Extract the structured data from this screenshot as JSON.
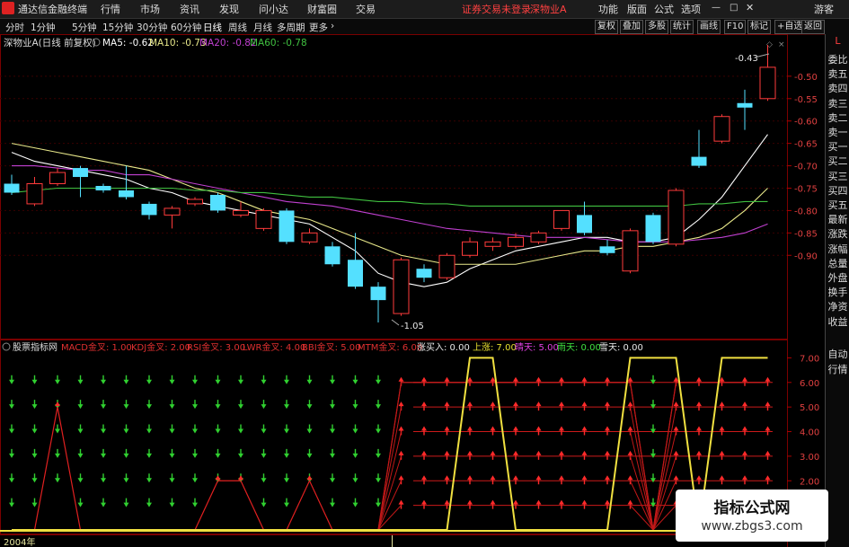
{
  "app": {
    "title": "通达信金融终端",
    "menu": [
      "行情",
      "市场",
      "资讯",
      "发现",
      "问小达",
      "财富圈",
      "交易"
    ],
    "status_text": "证券交易未登录",
    "stock_name": "深物业A",
    "right_menu": [
      "功能",
      "版面",
      "公式",
      "选项"
    ],
    "guest": "游客"
  },
  "periods": [
    "分时",
    "1分钟",
    "5分钟",
    "15分钟",
    "30分钟",
    "60分钟",
    "日线",
    "周线",
    "月线",
    "多周期",
    "更多"
  ],
  "active_period": "日线",
  "toolbar": [
    "复权",
    "叠加",
    "多股",
    "统计",
    "画线",
    "F10",
    "标记",
    "+自选",
    "返回"
  ],
  "main_legend": {
    "title": "深物业A(日线 前复权)",
    "items": [
      {
        "label": "MA5: -0.62",
        "color": "#ffffff"
      },
      {
        "label": "MA10: -0.73",
        "color": "#e8e88a"
      },
      {
        "label": "MA20: -0.82",
        "color": "#c040d0"
      },
      {
        "label": "MA60: -0.78",
        "color": "#40c040"
      }
    ]
  },
  "annotations": {
    "high": "-0.43",
    "low": "-1.05"
  },
  "price_axis": [
    "-0.50",
    "-0.55",
    "-0.60",
    "-0.65",
    "-0.70",
    "-0.75",
    "-0.80",
    "-0.85",
    "-0.90"
  ],
  "indicator_legend": {
    "title": "股票指标网",
    "items": [
      {
        "label": "MACD金叉: 1.00",
        "color": "#e03030"
      },
      {
        "label": "KDJ金叉: 2.00",
        "color": "#e03030"
      },
      {
        "label": "RSI金叉: 3.00",
        "color": "#e03030"
      },
      {
        "label": "LWR金叉: 4.00",
        "color": "#e03030"
      },
      {
        "label": "BBI金叉: 5.00",
        "color": "#e03030"
      },
      {
        "label": "MTM金叉: 6.00",
        "color": "#e03030"
      },
      {
        "label": "涨买入: 0.00",
        "color": "#e8e8e8"
      },
      {
        "label": "上涨: 7.00",
        "color": "#e8e030"
      },
      {
        "label": "晴天: 5.00",
        "color": "#e040e0"
      },
      {
        "label": "雨天: 0.00",
        "color": "#40e040"
      },
      {
        "label": "雪天: 0.00",
        "color": "#e8e8e8"
      }
    ]
  },
  "indicator_axis": [
    "7.00",
    "6.00",
    "5.00",
    "4.00",
    "3.00",
    "2.00"
  ],
  "date_label": "2004年",
  "side_panel": {
    "top": "L",
    "items": [
      "委比",
      "卖五",
      "卖四",
      "卖三",
      "卖二",
      "卖一",
      "买一",
      "买二",
      "买三",
      "买四",
      "买五",
      "最新",
      "涨跌",
      "涨幅",
      "总量",
      "外盘",
      "换手",
      "净资",
      "收益"
    ],
    "bottom": [
      "自动",
      "行情"
    ]
  },
  "watermark": {
    "line1": "指标公式网",
    "line2": "www.zbgs3.com"
  },
  "chart_data": {
    "type": "candlestick",
    "price_ylim": [
      -1.08,
      -0.41
    ],
    "candles": [
      {
        "o": -0.76,
        "c": -0.74,
        "h": -0.72,
        "l": -0.765,
        "up": false
      },
      {
        "o": -0.74,
        "c": -0.785,
        "h": -0.725,
        "l": -0.79,
        "up": true
      },
      {
        "o": -0.715,
        "c": -0.74,
        "h": -0.705,
        "l": -0.745,
        "up": true
      },
      {
        "o": -0.705,
        "c": -0.725,
        "h": -0.7,
        "l": -0.77,
        "up": false
      },
      {
        "o": -0.745,
        "c": -0.755,
        "h": -0.74,
        "l": -0.76,
        "up": false
      },
      {
        "o": -0.755,
        "c": -0.77,
        "h": -0.7,
        "l": -0.775,
        "up": false
      },
      {
        "o": -0.785,
        "c": -0.81,
        "h": -0.78,
        "l": -0.82,
        "up": false
      },
      {
        "o": -0.795,
        "c": -0.81,
        "h": -0.79,
        "l": -0.84,
        "up": true
      },
      {
        "o": -0.775,
        "c": -0.785,
        "h": -0.77,
        "l": -0.79,
        "up": true
      },
      {
        "o": -0.765,
        "c": -0.8,
        "h": -0.76,
        "l": -0.805,
        "up": false
      },
      {
        "o": -0.8,
        "c": -0.81,
        "h": -0.78,
        "l": -0.815,
        "up": true
      },
      {
        "o": -0.8,
        "c": -0.84,
        "h": -0.795,
        "l": -0.845,
        "up": true
      },
      {
        "o": -0.8,
        "c": -0.87,
        "h": -0.795,
        "l": -0.875,
        "up": false
      },
      {
        "o": -0.85,
        "c": -0.87,
        "h": -0.84,
        "l": -0.875,
        "up": true
      },
      {
        "o": -0.88,
        "c": -0.92,
        "h": -0.87,
        "l": -0.925,
        "up": false
      },
      {
        "o": -0.91,
        "c": -0.97,
        "h": -0.85,
        "l": -0.975,
        "up": false
      },
      {
        "o": -0.97,
        "c": -1.0,
        "h": -0.96,
        "l": -1.05,
        "up": false
      },
      {
        "o": -1.03,
        "c": -0.91,
        "h": -0.905,
        "l": -1.035,
        "up": true
      },
      {
        "o": -0.93,
        "c": -0.95,
        "h": -0.92,
        "l": -0.96,
        "up": false
      },
      {
        "o": -0.95,
        "c": -0.9,
        "h": -0.895,
        "l": -0.955,
        "up": true
      },
      {
        "o": -0.9,
        "c": -0.87,
        "h": -0.86,
        "l": -0.905,
        "up": true
      },
      {
        "o": -0.88,
        "c": -0.87,
        "h": -0.86,
        "l": -0.89,
        "up": true
      },
      {
        "o": -0.88,
        "c": -0.86,
        "h": -0.85,
        "l": -0.885,
        "up": true
      },
      {
        "o": -0.87,
        "c": -0.85,
        "h": -0.845,
        "l": -0.875,
        "up": true
      },
      {
        "o": -0.84,
        "c": -0.8,
        "h": -0.8,
        "l": -0.845,
        "up": true
      },
      {
        "o": -0.81,
        "c": -0.85,
        "h": -0.78,
        "l": -0.855,
        "up": false
      },
      {
        "o": -0.88,
        "c": -0.895,
        "h": -0.865,
        "l": -0.9,
        "up": false
      },
      {
        "o": -0.935,
        "c": -0.845,
        "h": -0.84,
        "l": -0.94,
        "up": true
      },
      {
        "o": -0.81,
        "c": -0.87,
        "h": -0.805,
        "l": -0.875,
        "up": false
      },
      {
        "o": -0.875,
        "c": -0.755,
        "h": -0.75,
        "l": -0.88,
        "up": true
      },
      {
        "o": -0.7,
        "c": -0.68,
        "h": -0.62,
        "l": -0.705,
        "up": false
      },
      {
        "o": -0.645,
        "c": -0.59,
        "h": -0.585,
        "l": -0.65,
        "up": true
      },
      {
        "o": -0.56,
        "c": -0.57,
        "h": -0.53,
        "l": -0.62,
        "up": false
      },
      {
        "o": -0.55,
        "c": -0.48,
        "h": -0.43,
        "l": -0.555,
        "up": true
      }
    ],
    "ma": [
      {
        "name": "MA5",
        "color": "#ffffff",
        "values": [
          -0.67,
          -0.69,
          -0.7,
          -0.71,
          -0.72,
          -0.73,
          -0.75,
          -0.76,
          -0.78,
          -0.79,
          -0.8,
          -0.81,
          -0.82,
          -0.83,
          -0.86,
          -0.89,
          -0.94,
          -0.96,
          -0.97,
          -0.96,
          -0.93,
          -0.91,
          -0.89,
          -0.88,
          -0.87,
          -0.86,
          -0.86,
          -0.87,
          -0.87,
          -0.86,
          -0.82,
          -0.77,
          -0.7,
          -0.63
        ]
      },
      {
        "name": "MA10",
        "color": "#e8e88a",
        "values": [
          -0.65,
          -0.66,
          -0.67,
          -0.68,
          -0.69,
          -0.7,
          -0.71,
          -0.73,
          -0.75,
          -0.76,
          -0.78,
          -0.8,
          -0.81,
          -0.82,
          -0.84,
          -0.86,
          -0.88,
          -0.9,
          -0.91,
          -0.92,
          -0.92,
          -0.92,
          -0.92,
          -0.91,
          -0.9,
          -0.89,
          -0.89,
          -0.88,
          -0.88,
          -0.87,
          -0.86,
          -0.84,
          -0.8,
          -0.75
        ]
      },
      {
        "name": "MA20",
        "color": "#c040d0",
        "values": [
          -0.7,
          -0.7,
          -0.705,
          -0.71,
          -0.71,
          -0.72,
          -0.72,
          -0.73,
          -0.74,
          -0.75,
          -0.76,
          -0.77,
          -0.78,
          -0.785,
          -0.79,
          -0.8,
          -0.81,
          -0.82,
          -0.83,
          -0.84,
          -0.845,
          -0.85,
          -0.855,
          -0.86,
          -0.86,
          -0.86,
          -0.865,
          -0.87,
          -0.87,
          -0.87,
          -0.865,
          -0.86,
          -0.85,
          -0.83
        ]
      },
      {
        "name": "MA60",
        "color": "#40c040",
        "values": [
          -0.76,
          -0.755,
          -0.75,
          -0.75,
          -0.75,
          -0.75,
          -0.75,
          -0.75,
          -0.755,
          -0.755,
          -0.76,
          -0.76,
          -0.765,
          -0.77,
          -0.77,
          -0.775,
          -0.78,
          -0.78,
          -0.785,
          -0.785,
          -0.79,
          -0.79,
          -0.79,
          -0.79,
          -0.79,
          -0.79,
          -0.79,
          -0.79,
          -0.79,
          -0.79,
          -0.785,
          -0.785,
          -0.78,
          -0.78
        ]
      }
    ],
    "ind_ylim": [
      0,
      7.6
    ],
    "up_signal": [
      0,
      0,
      0,
      0,
      0,
      0,
      0,
      0,
      0,
      0,
      0,
      0,
      0,
      0,
      0,
      0,
      0,
      0,
      0,
      0,
      7,
      7,
      0,
      0,
      0,
      0,
      0,
      7,
      7,
      7,
      0,
      7,
      7,
      7
    ],
    "sunny": [
      0,
      0,
      5,
      0,
      0,
      0,
      0,
      0,
      0,
      2,
      2,
      0,
      0,
      2,
      0,
      0,
      0,
      6,
      6,
      6,
      6,
      6,
      6,
      6,
      6,
      6,
      6,
      6,
      0,
      6,
      6,
      6,
      6,
      6
    ],
    "rain_count": 17,
    "weather_count": [
      6,
      6,
      5,
      6,
      6,
      6,
      6,
      6,
      6,
      5,
      5,
      6,
      6,
      5,
      6,
      6,
      6,
      0,
      0,
      0,
      0,
      0,
      0,
      0,
      0,
      0,
      0,
      0,
      6,
      0,
      0,
      0,
      0,
      0
    ]
  }
}
